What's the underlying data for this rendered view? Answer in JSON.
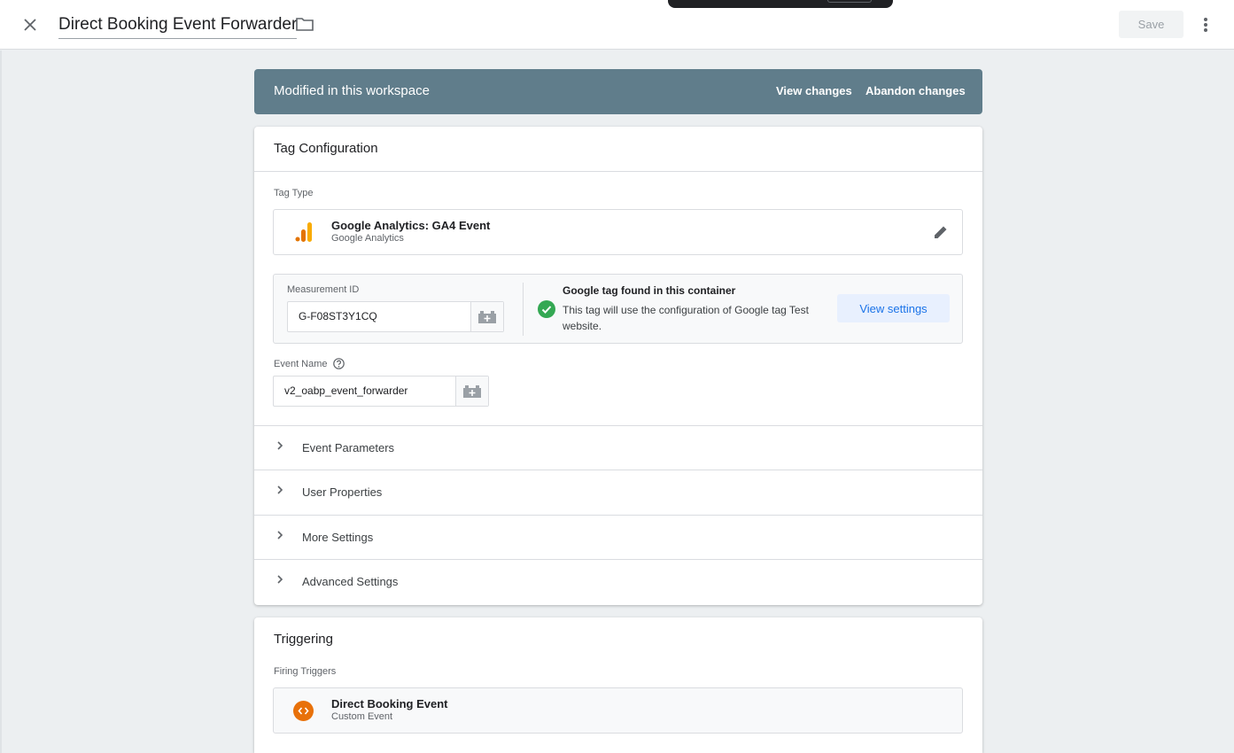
{
  "header": {
    "title": "Direct Booking Event Forwarder",
    "save_label": "Save"
  },
  "banner": {
    "title": "Modified in this workspace",
    "view_changes": "View changes",
    "abandon_changes": "Abandon changes"
  },
  "tag_config": {
    "heading": "Tag Configuration",
    "tag_type_label": "Tag Type",
    "tag_type_name": "Google Analytics: GA4 Event",
    "tag_type_vendor": "Google Analytics",
    "measurement_id_label": "Measurement ID",
    "measurement_id_value": "G-F08ST3Y1CQ",
    "found_title": "Google tag found in this container",
    "found_desc": "This tag will use the configuration of Google tag Test website.",
    "view_settings": "View settings",
    "event_name_label": "Event Name",
    "event_name_value": "v2_oabp_event_forwarder",
    "sections": [
      "Event Parameters",
      "User Properties",
      "More Settings",
      "Advanced Settings"
    ]
  },
  "triggering": {
    "heading": "Triggering",
    "firing_label": "Firing Triggers",
    "trigger_name": "Direct Booking Event",
    "trigger_type": "Custom Event"
  },
  "colors": {
    "banner": "#607d8b",
    "ga_orange": "#f9ab00",
    "ga_dark_orange": "#e37400",
    "check_green": "#34a853",
    "trigger_orange": "#e8710a",
    "link_blue": "#1a73e8"
  }
}
